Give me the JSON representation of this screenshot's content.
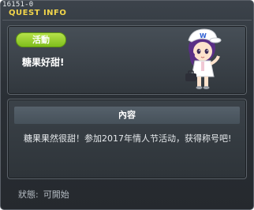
{
  "header": {
    "quest_id": "16151-0",
    "window_title": "QUEST INFO"
  },
  "quest": {
    "badge": "活動",
    "name": "糖果好甜!",
    "content_header": "內容",
    "description": "糖果果然很甜！参加2017年情人节活动，获得称号吧!"
  },
  "status": {
    "label": "狀態:",
    "value": "可開始"
  },
  "colors": {
    "title": "#f2d54a",
    "badge": "#8fcb26",
    "background": "#2b3036"
  }
}
